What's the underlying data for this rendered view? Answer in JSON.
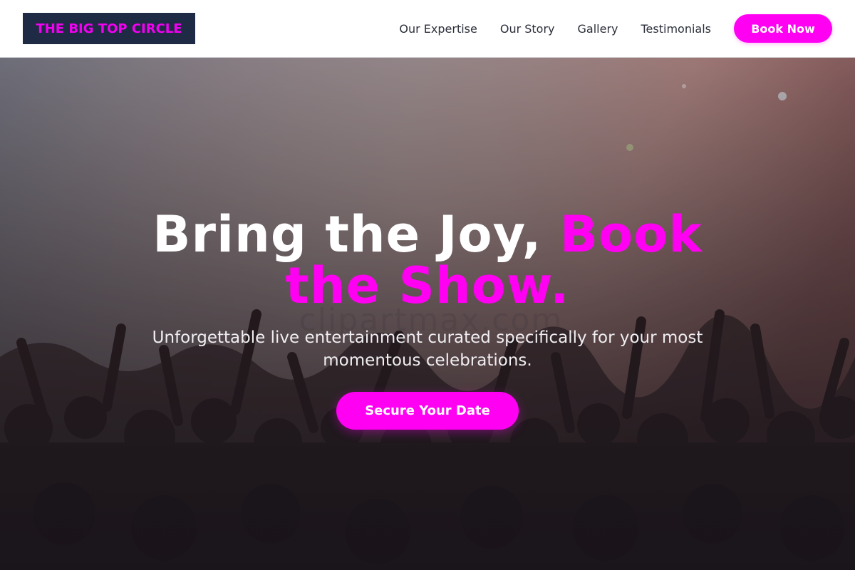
{
  "brand": {
    "name": "THE BIG TOP CIRCLE"
  },
  "nav": {
    "items": [
      {
        "label": "Our Expertise"
      },
      {
        "label": "Our Story"
      },
      {
        "label": "Gallery"
      },
      {
        "label": "Testimonials"
      }
    ],
    "cta_label": "Book Now"
  },
  "hero": {
    "title_plain": "Bring the Joy, ",
    "title_accent": "Book the Show.",
    "subtitle": "Unforgettable live entertainment curated specifically for your most momentous celebrations.",
    "cta_label": "Secure Your Date",
    "watermark": "clipartmax.com",
    "background": "concert-crowd-photo"
  },
  "colors": {
    "accent": "#ff00f2",
    "logo_bg": "#1f2a44",
    "header_bg": "#ffffff",
    "nav_text": "#2b2f3a"
  }
}
